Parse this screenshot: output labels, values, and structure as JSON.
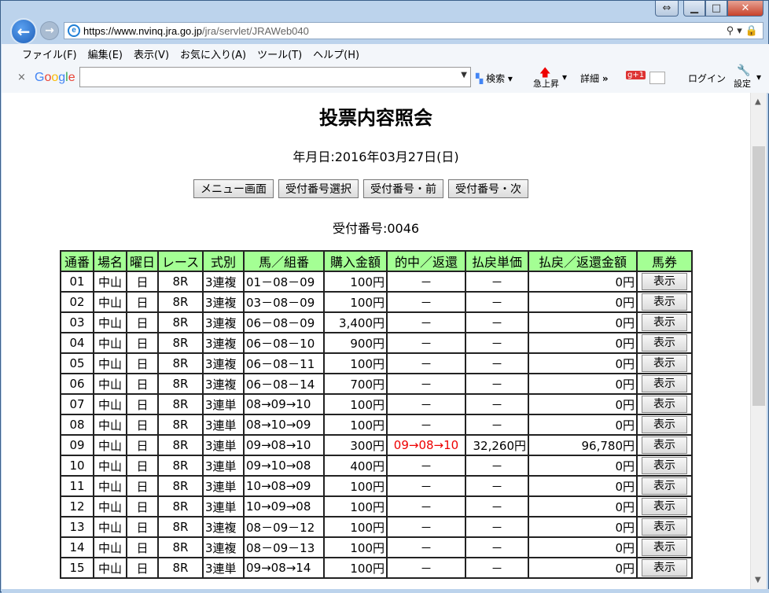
{
  "browser": {
    "url_host": "https://www.nvinq.jra.go.jp",
    "url_path": "/jra/servlet/JRAWeb040",
    "caption_min": "▁",
    "caption_max": "□",
    "caption_close": "✕",
    "menu": [
      "ファイル(F)",
      "編集(E)",
      "表示(V)",
      "お気に入り(A)",
      "ツール(T)",
      "ヘルプ(H)"
    ],
    "google_toolbar": {
      "close": "×",
      "logo": "Google",
      "search_label": "検索",
      "trend_label": "急上昇",
      "more_label": "詳細",
      "more_arrows": "»",
      "login_label": "ログイン",
      "settings_label": "設定"
    }
  },
  "page": {
    "title": "投票内容照会",
    "date_label": "年月日:2016年03月27日(日)",
    "buttons": [
      "メニュー画面",
      "受付番号選択",
      "受付番号・前",
      "受付番号・次"
    ],
    "receipt_label": "受付番号:0046"
  },
  "table": {
    "headers": [
      "通番",
      "場名",
      "曜日",
      "レース",
      "式別",
      "馬／組番",
      "購入金額",
      "的中／返還",
      "払戻単価",
      "払戻／返還金額",
      "馬券"
    ],
    "rows": [
      {
        "no": "01",
        "venue": "中山",
        "day": "日",
        "race": "8R",
        "type": "3連複",
        "combo": "01－08－09",
        "amount": "100円",
        "hit": "－",
        "unit": "－",
        "payout": "0円",
        "btn": "表示"
      },
      {
        "no": "02",
        "venue": "中山",
        "day": "日",
        "race": "8R",
        "type": "3連複",
        "combo": "03－08－09",
        "amount": "100円",
        "hit": "－",
        "unit": "－",
        "payout": "0円",
        "btn": "表示"
      },
      {
        "no": "03",
        "venue": "中山",
        "day": "日",
        "race": "8R",
        "type": "3連複",
        "combo": "06－08－09",
        "amount": "3,400円",
        "hit": "－",
        "unit": "－",
        "payout": "0円",
        "btn": "表示"
      },
      {
        "no": "04",
        "venue": "中山",
        "day": "日",
        "race": "8R",
        "type": "3連複",
        "combo": "06－08－10",
        "amount": "900円",
        "hit": "－",
        "unit": "－",
        "payout": "0円",
        "btn": "表示"
      },
      {
        "no": "05",
        "venue": "中山",
        "day": "日",
        "race": "8R",
        "type": "3連複",
        "combo": "06－08－11",
        "amount": "100円",
        "hit": "－",
        "unit": "－",
        "payout": "0円",
        "btn": "表示"
      },
      {
        "no": "06",
        "venue": "中山",
        "day": "日",
        "race": "8R",
        "type": "3連複",
        "combo": "06－08－14",
        "amount": "700円",
        "hit": "－",
        "unit": "－",
        "payout": "0円",
        "btn": "表示"
      },
      {
        "no": "07",
        "venue": "中山",
        "day": "日",
        "race": "8R",
        "type": "3連単",
        "combo": "08→09→10",
        "amount": "100円",
        "hit": "－",
        "unit": "－",
        "payout": "0円",
        "btn": "表示"
      },
      {
        "no": "08",
        "venue": "中山",
        "day": "日",
        "race": "8R",
        "type": "3連単",
        "combo": "08→10→09",
        "amount": "100円",
        "hit": "－",
        "unit": "－",
        "payout": "0円",
        "btn": "表示"
      },
      {
        "no": "09",
        "venue": "中山",
        "day": "日",
        "race": "8R",
        "type": "3連単",
        "combo": "09→08→10",
        "amount": "300円",
        "hit": "09→08→10",
        "unit": "32,260円",
        "payout": "96,780円",
        "btn": "表示"
      },
      {
        "no": "10",
        "venue": "中山",
        "day": "日",
        "race": "8R",
        "type": "3連単",
        "combo": "09→10→08",
        "amount": "400円",
        "hit": "－",
        "unit": "－",
        "payout": "0円",
        "btn": "表示"
      },
      {
        "no": "11",
        "venue": "中山",
        "day": "日",
        "race": "8R",
        "type": "3連単",
        "combo": "10→08→09",
        "amount": "100円",
        "hit": "－",
        "unit": "－",
        "payout": "0円",
        "btn": "表示"
      },
      {
        "no": "12",
        "venue": "中山",
        "day": "日",
        "race": "8R",
        "type": "3連単",
        "combo": "10→09→08",
        "amount": "100円",
        "hit": "－",
        "unit": "－",
        "payout": "0円",
        "btn": "表示"
      },
      {
        "no": "13",
        "venue": "中山",
        "day": "日",
        "race": "8R",
        "type": "3連複",
        "combo": "08－09－12",
        "amount": "100円",
        "hit": "－",
        "unit": "－",
        "payout": "0円",
        "btn": "表示"
      },
      {
        "no": "14",
        "venue": "中山",
        "day": "日",
        "race": "8R",
        "type": "3連複",
        "combo": "08－09－13",
        "amount": "100円",
        "hit": "－",
        "unit": "－",
        "payout": "0円",
        "btn": "表示"
      },
      {
        "no": "15",
        "venue": "中山",
        "day": "日",
        "race": "8R",
        "type": "3連単",
        "combo": "09→08→14",
        "amount": "100円",
        "hit": "－",
        "unit": "－",
        "payout": "0円",
        "btn": "表示"
      }
    ]
  }
}
